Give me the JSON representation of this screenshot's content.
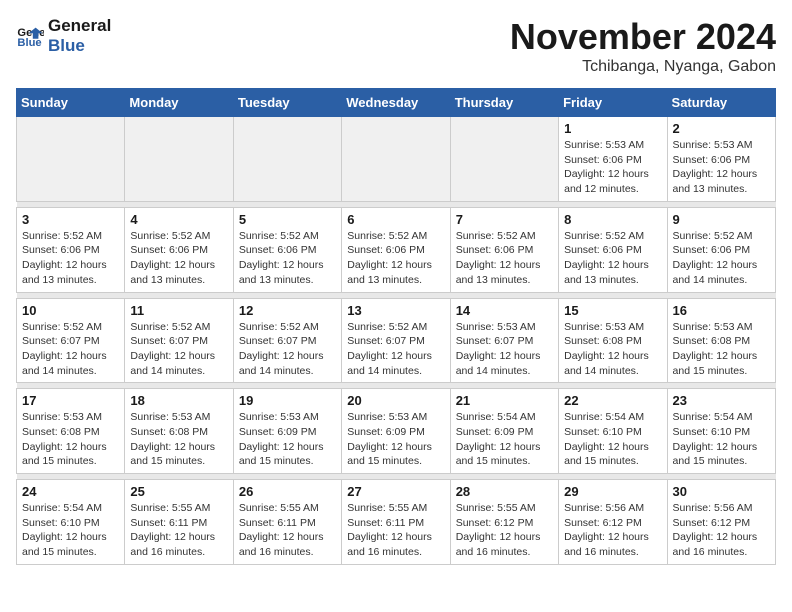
{
  "logo": {
    "text_general": "General",
    "text_blue": "Blue"
  },
  "title": "November 2024",
  "location": "Tchibanga, Nyanga, Gabon",
  "days_of_week": [
    "Sunday",
    "Monday",
    "Tuesday",
    "Wednesday",
    "Thursday",
    "Friday",
    "Saturday"
  ],
  "weeks": [
    [
      {
        "day": "",
        "info": ""
      },
      {
        "day": "",
        "info": ""
      },
      {
        "day": "",
        "info": ""
      },
      {
        "day": "",
        "info": ""
      },
      {
        "day": "",
        "info": ""
      },
      {
        "day": "1",
        "info": "Sunrise: 5:53 AM\nSunset: 6:06 PM\nDaylight: 12 hours and 12 minutes."
      },
      {
        "day": "2",
        "info": "Sunrise: 5:53 AM\nSunset: 6:06 PM\nDaylight: 12 hours and 13 minutes."
      }
    ],
    [
      {
        "day": "3",
        "info": "Sunrise: 5:52 AM\nSunset: 6:06 PM\nDaylight: 12 hours and 13 minutes."
      },
      {
        "day": "4",
        "info": "Sunrise: 5:52 AM\nSunset: 6:06 PM\nDaylight: 12 hours and 13 minutes."
      },
      {
        "day": "5",
        "info": "Sunrise: 5:52 AM\nSunset: 6:06 PM\nDaylight: 12 hours and 13 minutes."
      },
      {
        "day": "6",
        "info": "Sunrise: 5:52 AM\nSunset: 6:06 PM\nDaylight: 12 hours and 13 minutes."
      },
      {
        "day": "7",
        "info": "Sunrise: 5:52 AM\nSunset: 6:06 PM\nDaylight: 12 hours and 13 minutes."
      },
      {
        "day": "8",
        "info": "Sunrise: 5:52 AM\nSunset: 6:06 PM\nDaylight: 12 hours and 13 minutes."
      },
      {
        "day": "9",
        "info": "Sunrise: 5:52 AM\nSunset: 6:06 PM\nDaylight: 12 hours and 14 minutes."
      }
    ],
    [
      {
        "day": "10",
        "info": "Sunrise: 5:52 AM\nSunset: 6:07 PM\nDaylight: 12 hours and 14 minutes."
      },
      {
        "day": "11",
        "info": "Sunrise: 5:52 AM\nSunset: 6:07 PM\nDaylight: 12 hours and 14 minutes."
      },
      {
        "day": "12",
        "info": "Sunrise: 5:52 AM\nSunset: 6:07 PM\nDaylight: 12 hours and 14 minutes."
      },
      {
        "day": "13",
        "info": "Sunrise: 5:52 AM\nSunset: 6:07 PM\nDaylight: 12 hours and 14 minutes."
      },
      {
        "day": "14",
        "info": "Sunrise: 5:53 AM\nSunset: 6:07 PM\nDaylight: 12 hours and 14 minutes."
      },
      {
        "day": "15",
        "info": "Sunrise: 5:53 AM\nSunset: 6:08 PM\nDaylight: 12 hours and 14 minutes."
      },
      {
        "day": "16",
        "info": "Sunrise: 5:53 AM\nSunset: 6:08 PM\nDaylight: 12 hours and 15 minutes."
      }
    ],
    [
      {
        "day": "17",
        "info": "Sunrise: 5:53 AM\nSunset: 6:08 PM\nDaylight: 12 hours and 15 minutes."
      },
      {
        "day": "18",
        "info": "Sunrise: 5:53 AM\nSunset: 6:08 PM\nDaylight: 12 hours and 15 minutes."
      },
      {
        "day": "19",
        "info": "Sunrise: 5:53 AM\nSunset: 6:09 PM\nDaylight: 12 hours and 15 minutes."
      },
      {
        "day": "20",
        "info": "Sunrise: 5:53 AM\nSunset: 6:09 PM\nDaylight: 12 hours and 15 minutes."
      },
      {
        "day": "21",
        "info": "Sunrise: 5:54 AM\nSunset: 6:09 PM\nDaylight: 12 hours and 15 minutes."
      },
      {
        "day": "22",
        "info": "Sunrise: 5:54 AM\nSunset: 6:10 PM\nDaylight: 12 hours and 15 minutes."
      },
      {
        "day": "23",
        "info": "Sunrise: 5:54 AM\nSunset: 6:10 PM\nDaylight: 12 hours and 15 minutes."
      }
    ],
    [
      {
        "day": "24",
        "info": "Sunrise: 5:54 AM\nSunset: 6:10 PM\nDaylight: 12 hours and 15 minutes."
      },
      {
        "day": "25",
        "info": "Sunrise: 5:55 AM\nSunset: 6:11 PM\nDaylight: 12 hours and 16 minutes."
      },
      {
        "day": "26",
        "info": "Sunrise: 5:55 AM\nSunset: 6:11 PM\nDaylight: 12 hours and 16 minutes."
      },
      {
        "day": "27",
        "info": "Sunrise: 5:55 AM\nSunset: 6:11 PM\nDaylight: 12 hours and 16 minutes."
      },
      {
        "day": "28",
        "info": "Sunrise: 5:55 AM\nSunset: 6:12 PM\nDaylight: 12 hours and 16 minutes."
      },
      {
        "day": "29",
        "info": "Sunrise: 5:56 AM\nSunset: 6:12 PM\nDaylight: 12 hours and 16 minutes."
      },
      {
        "day": "30",
        "info": "Sunrise: 5:56 AM\nSunset: 6:12 PM\nDaylight: 12 hours and 16 minutes."
      }
    ]
  ]
}
